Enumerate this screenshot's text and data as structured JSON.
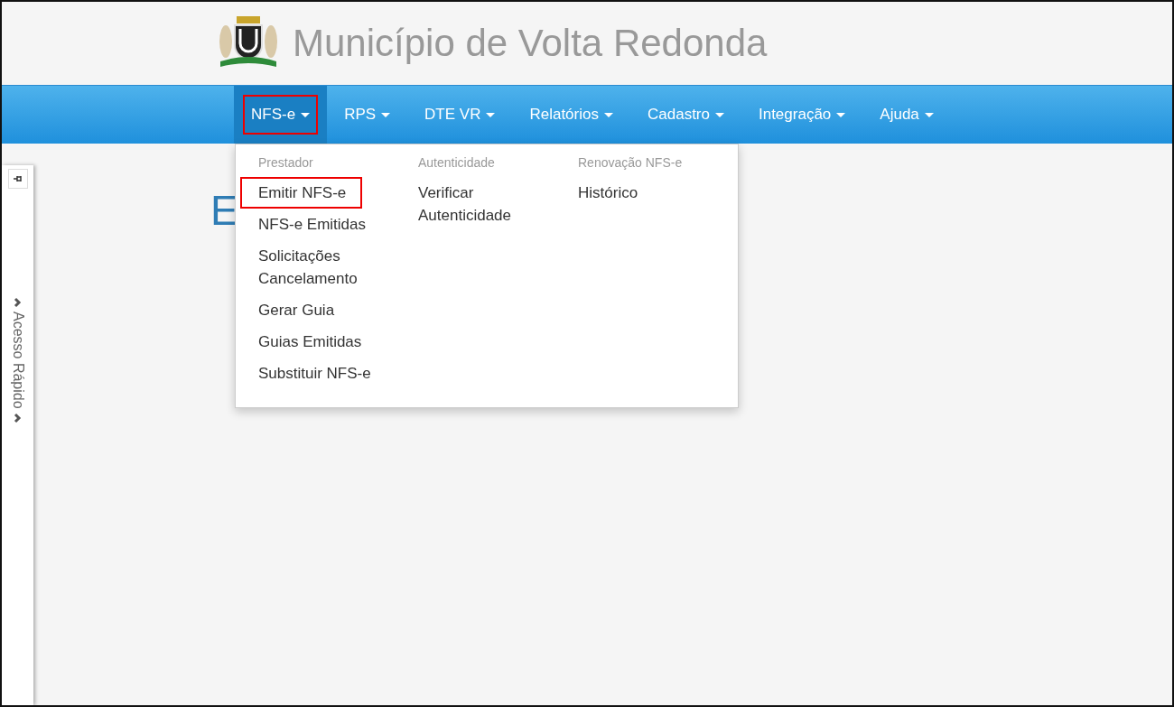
{
  "header": {
    "title": "Município de Volta Redonda"
  },
  "nav": {
    "items": [
      {
        "label": "NFS-e",
        "selected": true,
        "highlighted": true
      },
      {
        "label": "RPS",
        "selected": false,
        "highlighted": false
      },
      {
        "label": "DTE VR",
        "selected": false,
        "highlighted": false
      },
      {
        "label": "Relatórios",
        "selected": false,
        "highlighted": false
      },
      {
        "label": "Cadastro",
        "selected": false,
        "highlighted": false
      },
      {
        "label": "Integração",
        "selected": false,
        "highlighted": false
      },
      {
        "label": "Ajuda",
        "selected": false,
        "highlighted": false
      }
    ]
  },
  "dropdown": {
    "columns": [
      {
        "header": "Prestador",
        "items": [
          {
            "label": "Emitir NFS-e",
            "highlighted": true
          },
          {
            "label": "NFS-e Emitidas",
            "highlighted": false
          },
          {
            "label": "Solicitações Cancelamento",
            "highlighted": false
          },
          {
            "label": "Gerar Guia",
            "highlighted": false
          },
          {
            "label": "Guias Emitidas",
            "highlighted": false
          },
          {
            "label": "Substituir NFS-e",
            "highlighted": false
          }
        ]
      },
      {
        "header": "Autenticidade",
        "items": [
          {
            "label": "Verificar Autenticidade",
            "highlighted": false
          }
        ]
      },
      {
        "header": "Renovação NFS-e",
        "items": [
          {
            "label": "Histórico",
            "highlighted": false
          }
        ]
      }
    ]
  },
  "page_heading": "E",
  "quick_access": {
    "label": "Acesso Rápido"
  }
}
